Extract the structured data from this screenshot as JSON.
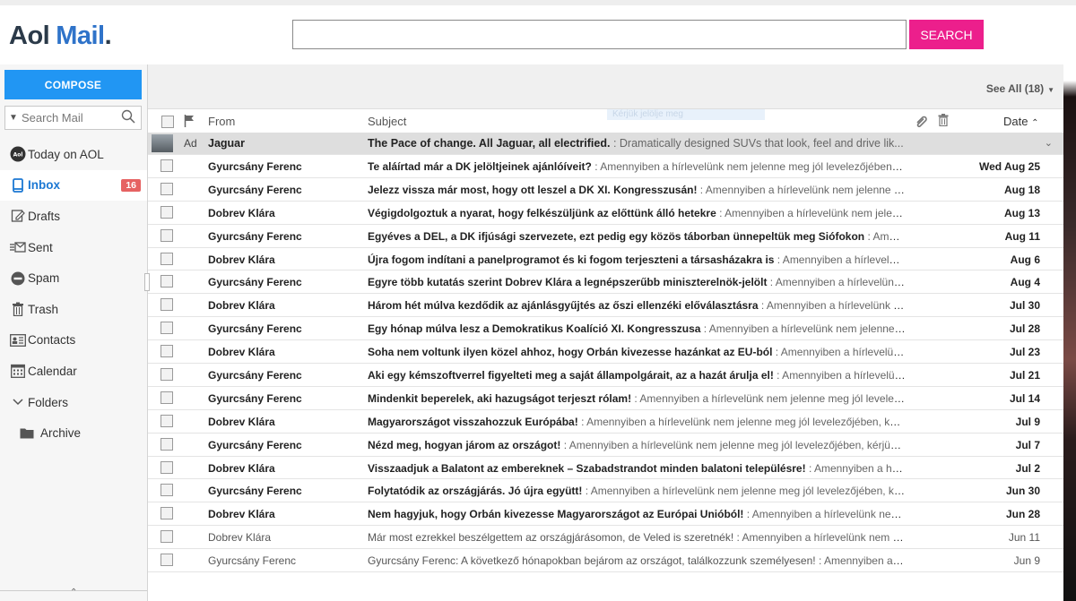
{
  "app": {
    "logo_aol": "Aol",
    "logo_mail": "Mail",
    "logo_dot": ".",
    "search_button": "SEARCH",
    "search_value": ""
  },
  "sidebar": {
    "compose": "COMPOSE",
    "search_placeholder": "Search Mail",
    "items": [
      {
        "label": "Today on AOL",
        "icon": "aol-icon"
      },
      {
        "label": "Inbox",
        "icon": "inbox-icon",
        "badge": "16"
      },
      {
        "label": "Drafts",
        "icon": "drafts-icon"
      },
      {
        "label": "Sent",
        "icon": "sent-icon"
      },
      {
        "label": "Spam",
        "icon": "spam-icon"
      },
      {
        "label": "Trash",
        "icon": "trash-icon"
      },
      {
        "label": "Contacts",
        "icon": "contacts-icon"
      },
      {
        "label": "Calendar",
        "icon": "calendar-icon"
      },
      {
        "label": "Folders",
        "icon": "chevron-down-icon"
      },
      {
        "label": "Archive",
        "icon": "folder-icon"
      }
    ]
  },
  "toolbar": {
    "see_all": "See All (18)"
  },
  "columns": {
    "from": "From",
    "subject": "Subject",
    "date": "Date",
    "drag_hint": "Kérjük jelölje meg"
  },
  "ad": {
    "label": "Ad",
    "from": "Jaguar",
    "subject": "The Pace of change. All Jaguar, all electrified.",
    "snippet": " : Dramatically designed SUVs that look, feel and drive lik..."
  },
  "emails": [
    {
      "from": "Gyurcsány Ferenc",
      "subject": "Te aláírtad már a DK jelöltjeinek ajánlóíveit?",
      "snippet": " : Amennyiben a hírlevelünk nem jelenne meg jól levelezőjében, kérjük kat...",
      "date": "Wed Aug 25",
      "unread": true
    },
    {
      "from": "Gyurcsány Ferenc",
      "subject": "Jelezz vissza már most, hogy ott leszel a DK XI. Kongresszusán!",
      "snippet": " : Amennyiben a hírlevelünk nem jelenne meg jól l...",
      "date": "Aug 18",
      "unread": true
    },
    {
      "from": "Dobrev Klára",
      "subject": "Végigdolgoztuk a nyarat, hogy felkészüljünk az előttünk álló hetekre",
      "snippet": " : Amennyiben a hírlevelünk nem jelenne me...",
      "date": "Aug 13",
      "unread": true
    },
    {
      "from": "Gyurcsány Ferenc",
      "subject": "Egyéves a DEL, a DK ifjúsági szervezete, ezt pedig egy közös táborban ünnepeltük meg Siófokon",
      "snippet": " : Amennyi...",
      "date": "Aug 11",
      "unread": true
    },
    {
      "from": "Dobrev Klára",
      "subject": "Újra fogom indítani a panelprogramot és ki fogom terjeszteni a társasházakra is",
      "snippet": " : Amennyiben a hírlevelünk ne...",
      "date": "Aug 6",
      "unread": true
    },
    {
      "from": "Gyurcsány Ferenc",
      "subject": "Egyre több kutatás szerint Dobrev Klára a legnépszerűbb miniszterelnök-jelölt",
      "snippet": " : Amennyiben a hírlevelünk nem j...",
      "date": "Aug 4",
      "unread": true
    },
    {
      "from": "Dobrev Klára",
      "subject": "Három hét múlva kezdődik az ajánlásgyűjtés az őszi ellenzéki előválasztásra",
      "snippet": " : Amennyiben a hírlevelünk nem jel...",
      "date": "Jul 30",
      "unread": true
    },
    {
      "from": "Gyurcsány Ferenc",
      "subject": "Egy hónap múlva lesz a Demokratikus Koalíció XI. Kongresszusa",
      "snippet": " : Amennyiben a hírlevelünk nem jelenne meg jól...",
      "date": "Jul 28",
      "unread": true
    },
    {
      "from": "Dobrev Klára",
      "subject": "Soha nem voltunk ilyen közel ahhoz, hogy Orbán kivezesse hazánkat az EU-ból",
      "snippet": " : Amennyiben a hírlevelünk ne...",
      "date": "Jul 23",
      "unread": true
    },
    {
      "from": "Gyurcsány Ferenc",
      "subject": "Aki egy kémszoftverrel figyelteti meg a saját állampolgárait, az a hazát árulja el!",
      "snippet": " : Amennyiben a hírlevelünk ne...",
      "date": "Jul 21",
      "unread": true
    },
    {
      "from": "Gyurcsány Ferenc",
      "subject": "Mindenkit beperelek, aki hazugságot terjeszt rólam!",
      "snippet": " : Amennyiben a hírlevelünk nem jelenne meg jól levelezőjében, ...",
      "date": "Jul 14",
      "unread": true
    },
    {
      "from": "Dobrev Klára",
      "subject": "Magyarországot visszahozzuk Európába!",
      "snippet": " : Amennyiben a hírlevelünk nem jelenne meg jól levelezőjében, kérjük kattint...",
      "date": "Jul 9",
      "unread": true
    },
    {
      "from": "Gyurcsány Ferenc",
      "subject": "Nézd meg, hogyan járom az országot!",
      "snippet": " : Amennyiben a hírlevelünk nem jelenne meg jól levelezőjében, kérjük kattintson ...",
      "date": "Jul 7",
      "unread": true
    },
    {
      "from": "Dobrev Klára",
      "subject": "Visszaadjuk a Balatont az embereknek – Szabadstrandot minden balatoni településre!",
      "snippet": " : Amennyiben a hírlevel...",
      "date": "Jul 2",
      "unread": true
    },
    {
      "from": "Gyurcsány Ferenc",
      "subject": "Folytatódik az országjárás. Jó újra együtt!",
      "snippet": " : Amennyiben a hírlevelünk nem jelenne meg jól levelezőjében, kérjük katti...",
      "date": "Jun 30",
      "unread": true
    },
    {
      "from": "Dobrev Klára",
      "subject": "Nem hagyjuk, hogy Orbán kivezesse Magyarországot az Európai Unióból!",
      "snippet": " : Amennyiben a hírlevelünk nem jelen...",
      "date": "Jun 28",
      "unread": true
    },
    {
      "from": "Dobrev Klára",
      "subject": "Már most ezrekkel beszélgettem az országjárásomon, de Veled is szeretnék!",
      "snippet": " : Amennyiben a hírlevelünk nem jelenne ...",
      "date": "Jun 11",
      "unread": false
    },
    {
      "from": "Gyurcsány Ferenc",
      "subject": "Gyurcsány Ferenc: A következő hónapokban bejárom az országot, találkozzunk személyesen!",
      "snippet": " : Amennyiben a hírlev...",
      "date": "Jun 9",
      "unread": false
    }
  ],
  "colors": {
    "compose_bg": "#2196f3",
    "search_button_bg": "#ec1f8c",
    "inbox_active": "#1c78d3",
    "badge_bg": "#e66262",
    "logo_mail": "#2f73c9"
  }
}
